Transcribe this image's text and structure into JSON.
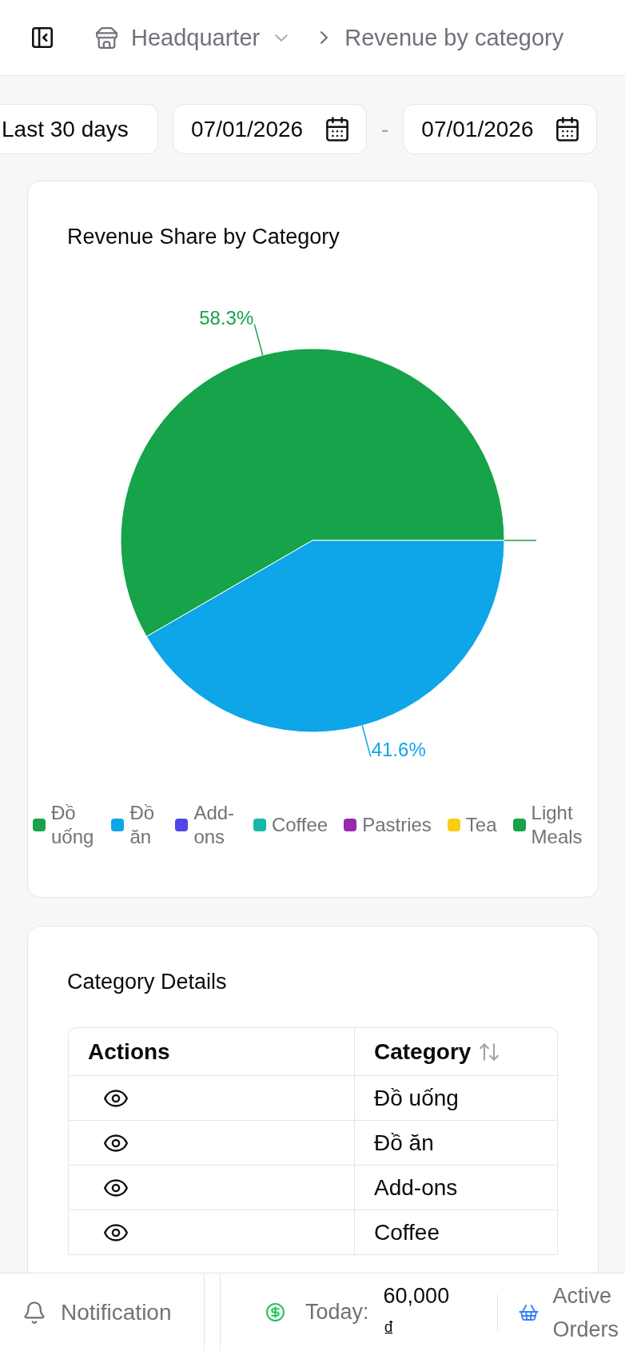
{
  "header": {
    "store": {
      "label": "Headquarter"
    },
    "page_title": "Revenue by category"
  },
  "filters": {
    "preset": {
      "label": "Last 30 days"
    },
    "date_from": {
      "value": "07/01/2026"
    },
    "separator": "-",
    "date_to": {
      "value": "07/01/2026"
    }
  },
  "revenue_card": {
    "chart_data": {
      "type": "pie",
      "title": "Revenue Share by Category",
      "categories": [
        "Đồ uống",
        "Đồ ăn",
        "Add-ons",
        "Coffee",
        "Pastries",
        "Tea",
        "Light Meals"
      ],
      "values": [
        58.3,
        41.6,
        0,
        0,
        0,
        0,
        0
      ],
      "value_labels": [
        "58.3%",
        "41.6%",
        null,
        null,
        null,
        null,
        null
      ],
      "legend": "bottom"
    },
    "slices": [
      {
        "color": "#16a34a"
      },
      {
        "color": "#0ea5e9"
      },
      {
        "color": "#4f46e5"
      },
      {
        "color": "#14b8a6"
      },
      {
        "color": "#9c27b0"
      },
      {
        "color": "#facc15"
      },
      {
        "color": "#16a34a"
      }
    ]
  },
  "details_card": {
    "title": "Category Details",
    "table": {
      "columns": [
        {
          "label": "Actions",
          "sortable": false
        },
        {
          "label": "Category",
          "sortable": true
        }
      ],
      "rows": [
        {
          "category": "Đồ uống"
        },
        {
          "category": "Đồ ăn"
        },
        {
          "category": "Add-ons"
        },
        {
          "category": "Coffee"
        }
      ]
    }
  },
  "bottom_bar": {
    "notification": {
      "label": "Notification"
    },
    "today": {
      "label": "Today:",
      "value": "60,000 ₫"
    },
    "active_orders": {
      "label": "Active Orders"
    }
  }
}
